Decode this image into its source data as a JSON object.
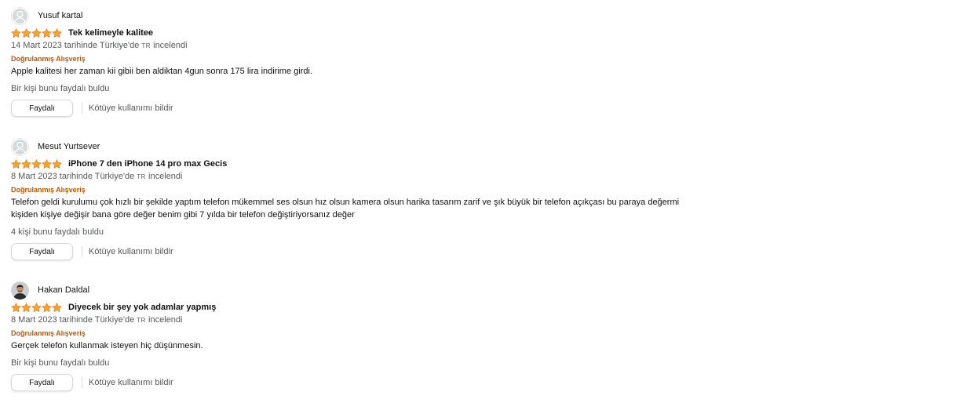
{
  "reviews": [
    {
      "author": "Yusuf kartal",
      "rating": 5,
      "rating_max": 5,
      "avatar": "default-avatar-icon",
      "title": "Tek kelimeyle kalitee",
      "date_prefix": "14 Mart 2023 tarihinde Türkiye'de",
      "lang_tag": "TR",
      "date_suffix": "incelendi",
      "verified": "Doğrulanmış Alışveriş",
      "body_lines": [
        "Apple kalitesi her zaman kii gibii ben aldiktan 4gun sonra 175 lira indirime girdi."
      ],
      "helpful_text": "Bir kişi bunu faydalı buldu",
      "helpful_button": "Faydalı",
      "report_link": "Kötüye kullanımı bildir"
    },
    {
      "author": "Mesut Yurtsever",
      "rating": 5,
      "rating_max": 5,
      "avatar": "default-avatar-icon",
      "title": "iPhone 7 den iPhone 14 pro max Gecis",
      "date_prefix": "8 Mart 2023 tarihinde Türkiye'de",
      "lang_tag": "TR",
      "date_suffix": "incelendi",
      "verified": "Doğrulanmış Alışveriş",
      "body_lines": [
        "Telefon geldi kurulumu çok hızlı bir şekilde yaptım telefon mükemmel ses olsun hız olsun kamera olsun harika tasarım zarif ve şık büyük bir telefon açıkçası bu paraya değermi",
        "kişiden kişiye değişir bana göre değer benim gibi 7 yılda bir telefon değiştiriyorsanız değer"
      ],
      "helpful_text": "4 kişi bunu faydalı buldu",
      "helpful_button": "Faydalı",
      "report_link": "Kötüye kullanımı bildir"
    },
    {
      "author": "Hakan Daldal",
      "rating": 5,
      "rating_max": 5,
      "avatar": "user-photo-avatar",
      "title": "Diyecek bir şey yok adamlar yapmış",
      "date_prefix": "8 Mart 2023 tarihinde Türkiye'de",
      "lang_tag": "TR",
      "date_suffix": "incelendi",
      "verified": "Doğrulanmış Alışveriş",
      "body_lines": [
        "Gerçek telefon kullanmak isteyen hiç düşünmesin."
      ],
      "helpful_text": "Bir kişi bunu faydalı buldu",
      "helpful_button": "Faydalı",
      "report_link": "Kötüye kullanımı bildir"
    }
  ],
  "colors": {
    "star": "#ffa41c",
    "verified": "#c45500",
    "secondary_text": "#565959",
    "button_border": "#d5d9d9"
  }
}
